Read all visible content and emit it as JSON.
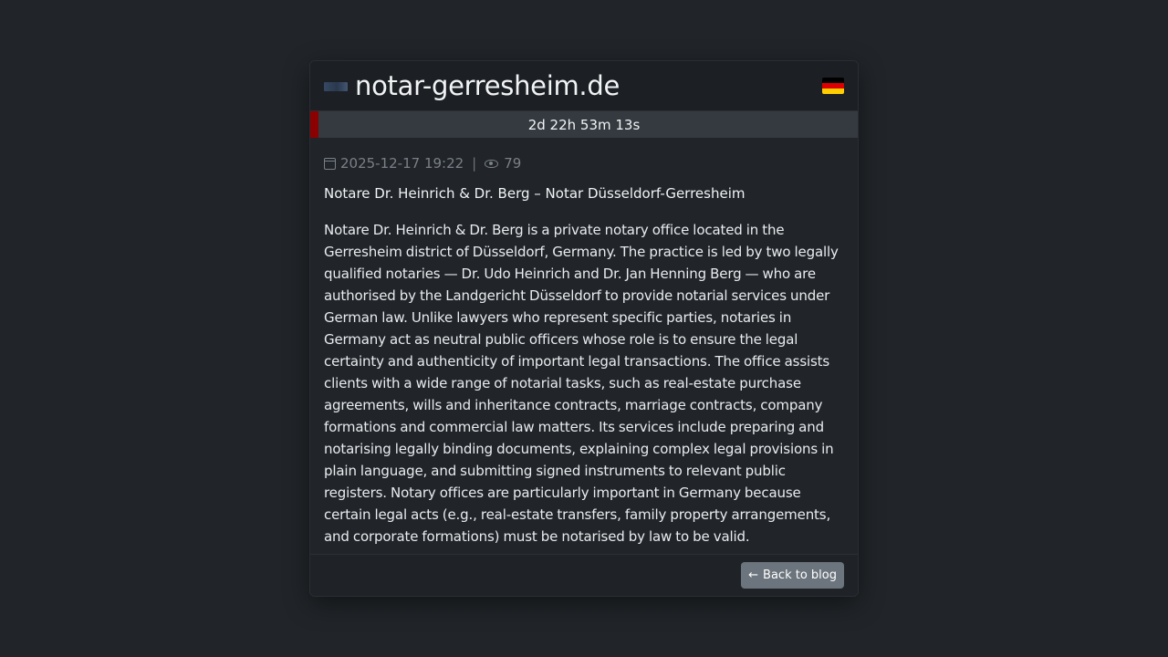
{
  "header": {
    "site_title": "notar-gerresheim.de",
    "favicon_icon": "site-favicon-icon",
    "flag_icon": "germany-flag-icon",
    "flag_colors": [
      "#000000",
      "#dd0000",
      "#ffce00"
    ]
  },
  "countdown": {
    "text": "2d 22h 53m 13s",
    "accent_color": "#8b0000"
  },
  "meta": {
    "date": "2025-12-17 19:22",
    "separator": "|",
    "views": "79"
  },
  "post": {
    "title": "Notare Dr. Heinrich & Dr. Berg – Notar Düsseldorf-Gerresheim",
    "body": "Notare Dr. Heinrich & Dr. Berg is a private notary office located in the Gerresheim district of Düsseldorf, Germany. The practice is led by two legally qualified notaries — Dr. Udo Heinrich and Dr. Jan Henning Berg — who are authorised by the Landgericht Düsseldorf to provide notarial services under German law. Unlike lawyers who represent specific parties, notaries in Germany act as neutral public officers whose role is to ensure the legal certainty and authenticity of important legal transactions. The office assists clients with a wide range of notarial tasks, such as real-estate purchase agreements, wills and inheritance contracts, marriage contracts, company formations and commercial law matters. Its services include preparing and notarising legally binding documents, explaining complex legal provisions in plain language, and submitting signed instruments to relevant public registers. Notary offices are particularly important in Germany because certain legal acts (e.g., real-estate transfers, family property arrangements, and corporate formations) must be notarised by law to be valid."
  },
  "footer": {
    "back_arrow": "←",
    "back_label": "Back to blog"
  }
}
